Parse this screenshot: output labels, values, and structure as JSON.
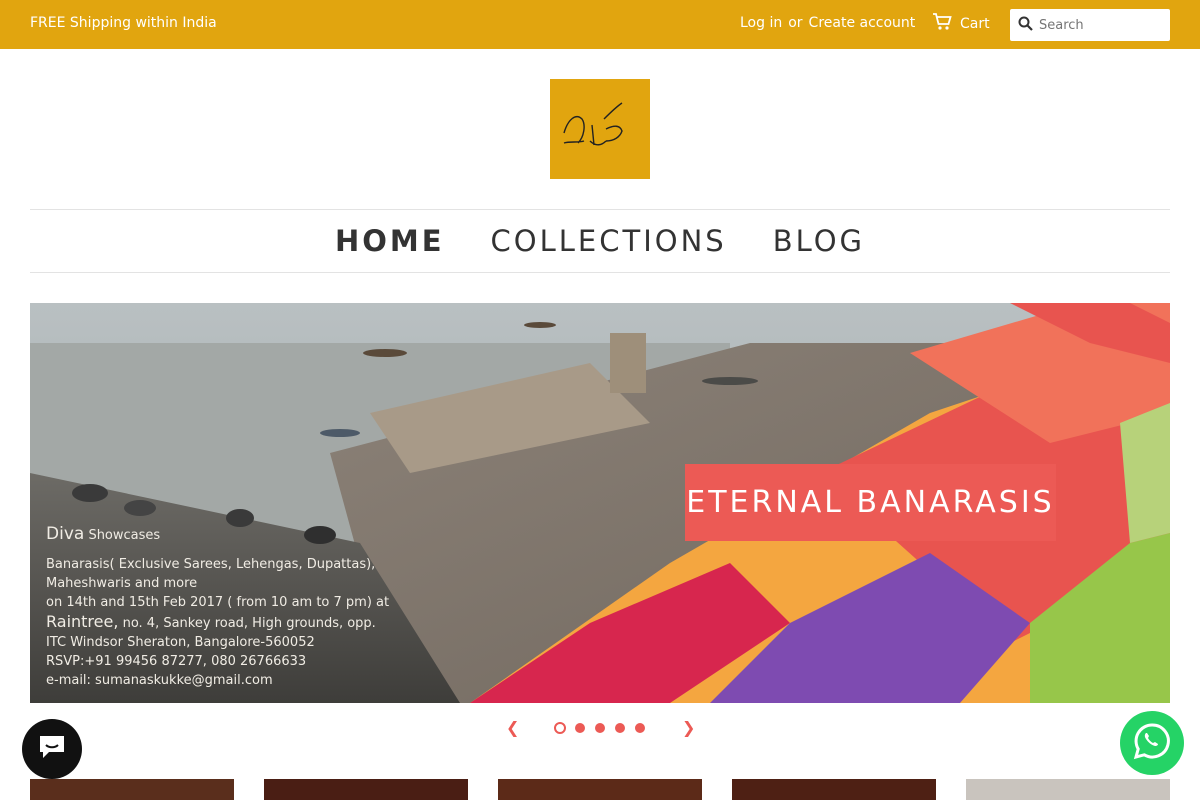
{
  "topbar": {
    "shipping": "FREE Shipping within India",
    "login": "Log in",
    "or": "or",
    "create_account": "Create account",
    "cart": "Cart",
    "search_placeholder": "Search"
  },
  "nav": {
    "items": [
      {
        "label": "HOME",
        "active": true
      },
      {
        "label": "COLLECTIONS",
        "active": false
      },
      {
        "label": "BLOG",
        "active": false
      }
    ]
  },
  "hero": {
    "caption": "ETERNAL BANARASIS",
    "brand": "Diva",
    "brand_suffix": "Showcases",
    "line1": "Banarasis( Exclusive Sarees, Lehengas, Dupattas),",
    "line2": "Maheshwaris and more",
    "line3": "on 14th and 15th Feb 2017 ( from 10 am to 7 pm) at",
    "venue": "Raintree,",
    "line4": "no. 4, Sankey road, High grounds, opp.",
    "line5": "ITC Windsor Sheraton, Bangalore-560052",
    "line6": "RSVP:+91 99456 87277, 080 26766633",
    "line7": "e-mail: sumanaskukke@gmail.com"
  },
  "slider": {
    "slide_count": 5,
    "active_index": 0
  },
  "colors": {
    "brand": "#e1a50f",
    "accent": "#ec5a55",
    "whatsapp": "#25d366",
    "chat": "#111111"
  },
  "icons": {
    "cart": "cart-icon",
    "search": "search-icon",
    "prev": "chevron-left-icon",
    "next": "chevron-right-icon",
    "chat": "chat-icon",
    "whatsapp": "whatsapp-icon"
  }
}
